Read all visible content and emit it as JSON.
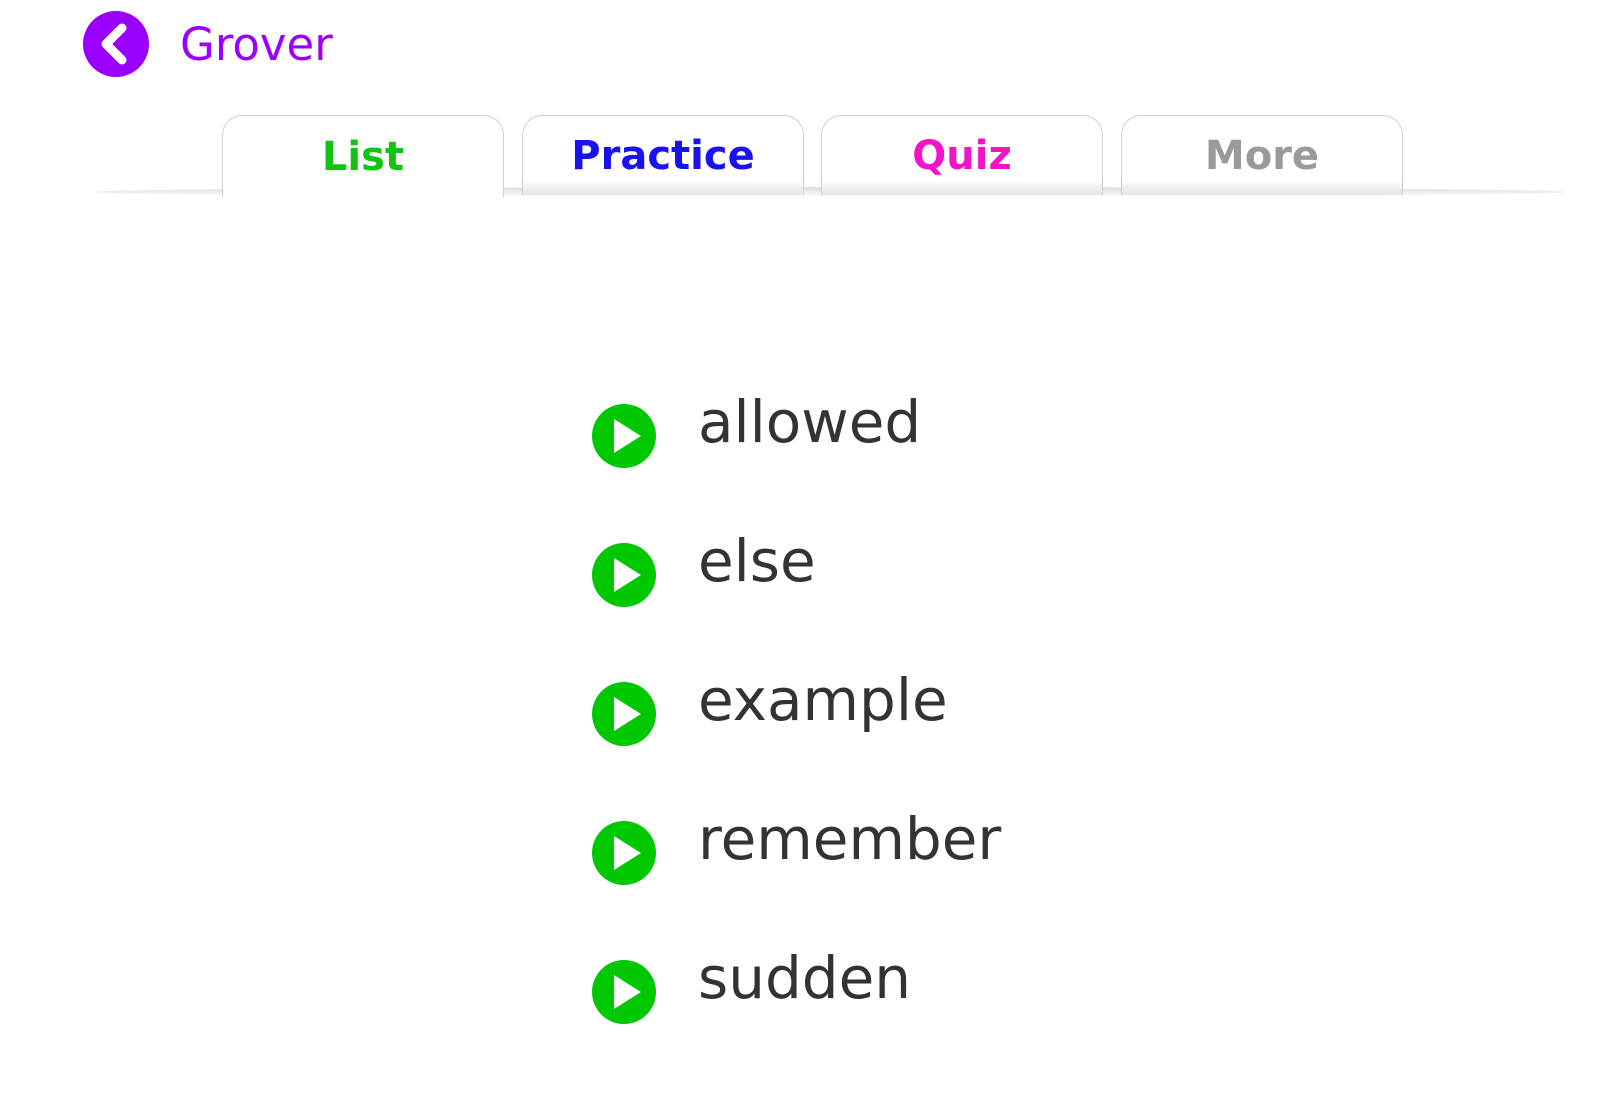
{
  "colors": {
    "brand": "#9a00ff",
    "play": "#00c800",
    "word_text": "#333333",
    "tab_border": "#cfcfcf"
  },
  "header": {
    "back_icon": "chevron-left-icon",
    "title": "Grover"
  },
  "tabs": [
    {
      "label": "List",
      "color": "#11c411",
      "active": true
    },
    {
      "label": "Practice",
      "color": "#1a11f0",
      "active": false
    },
    {
      "label": "Quiz",
      "color": "#f013c8",
      "active": false
    },
    {
      "label": "More",
      "color": "#9a9a9a",
      "active": false
    }
  ],
  "words": {
    "play_icon": "play-circle-icon",
    "items": [
      "allowed",
      "else",
      "example",
      "remember",
      "sudden"
    ]
  }
}
